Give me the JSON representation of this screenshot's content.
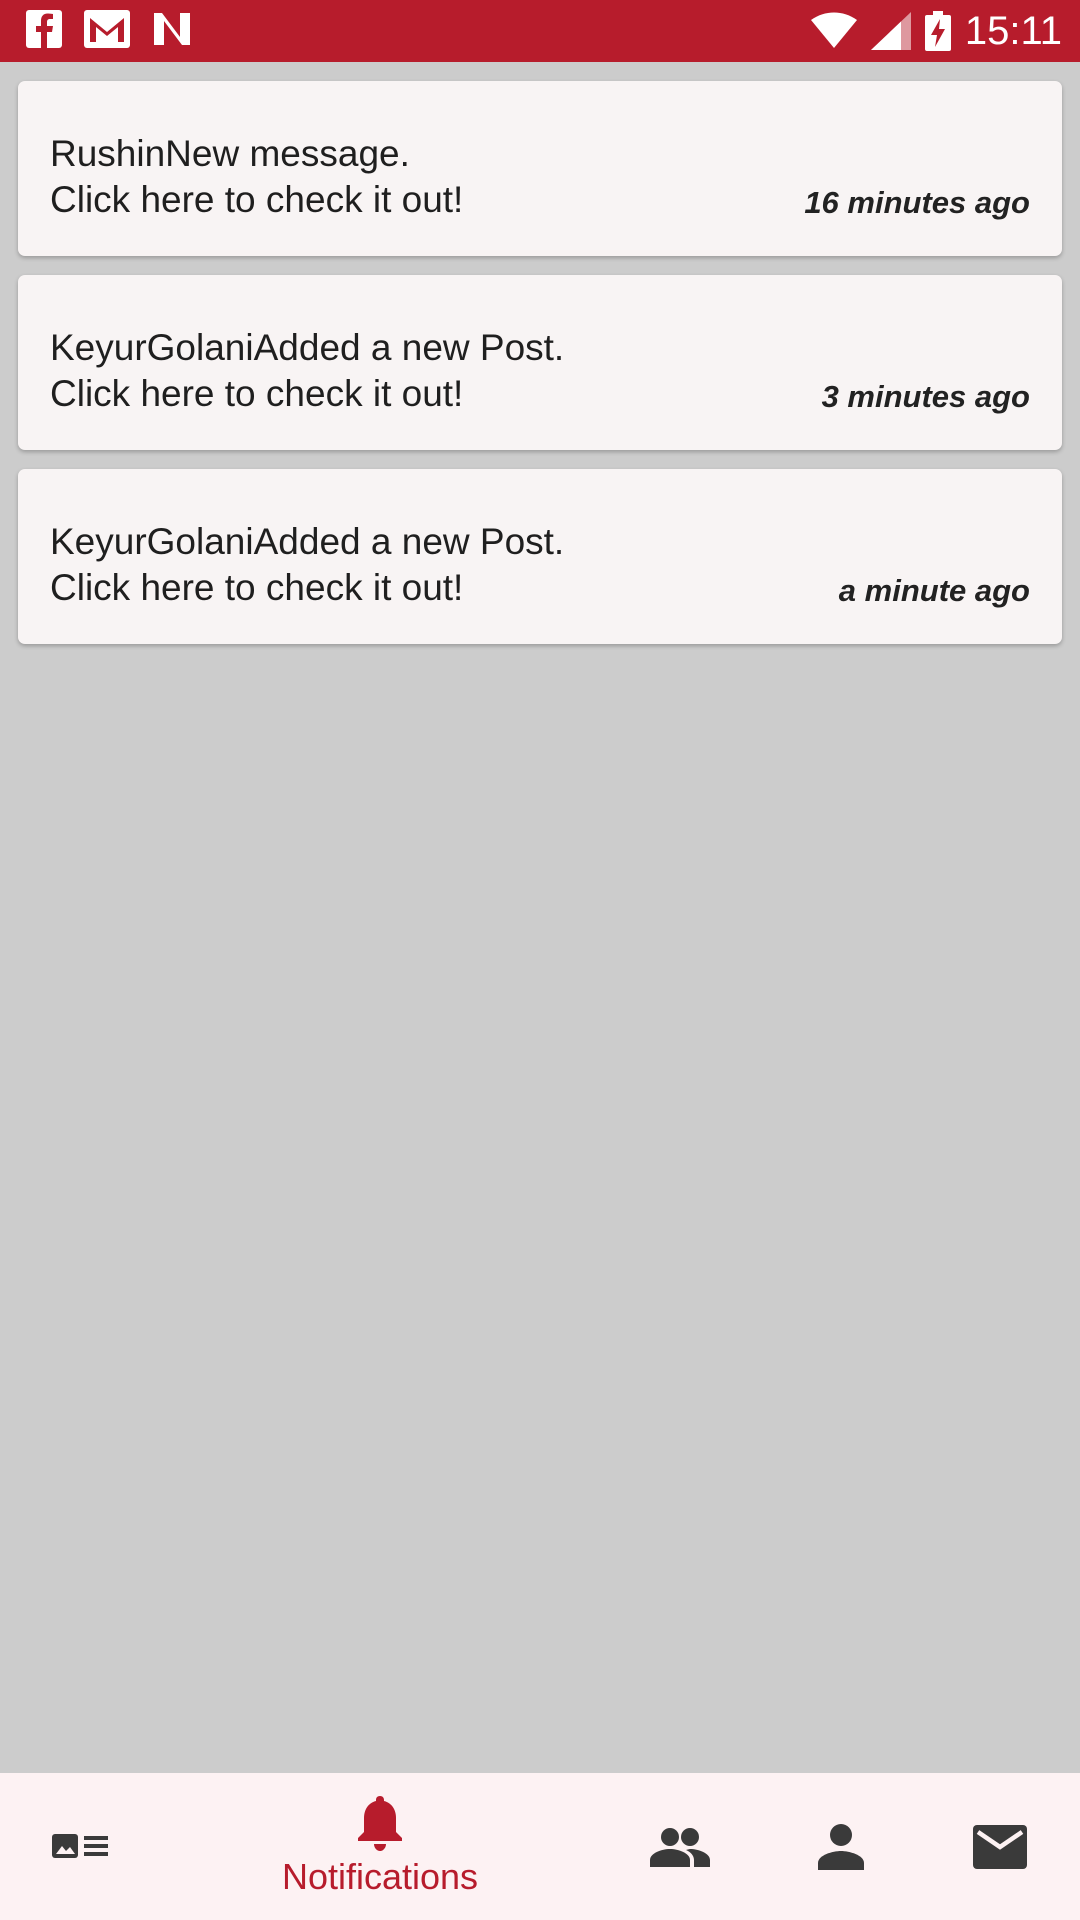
{
  "status_bar": {
    "time": "15:11",
    "left_icons": [
      "facebook-icon",
      "gmail-icon",
      "notification-n-icon"
    ],
    "right_icons": [
      "wifi-icon",
      "signal-icon",
      "battery-charging-icon"
    ]
  },
  "notifications": [
    {
      "line1": "RushinNew message.",
      "line2": "Click here to check it out!",
      "time": "16 minutes ago"
    },
    {
      "line1": "KeyurGolaniAdded a new Post.",
      "line2": "Click here to check it out!",
      "time": "3 minutes ago"
    },
    {
      "line1": "KeyurGolaniAdded a new Post.",
      "line2": "Click here to check it out!",
      "time": "a minute ago"
    }
  ],
  "bottom_nav": {
    "items": [
      {
        "icon": "feed-icon",
        "label": ""
      },
      {
        "icon": "bell-icon",
        "label": "Notifications",
        "active": true
      },
      {
        "icon": "people-icon",
        "label": ""
      },
      {
        "icon": "person-icon",
        "label": ""
      },
      {
        "icon": "mail-icon",
        "label": ""
      }
    ]
  },
  "colors": {
    "accent": "#b71c2c",
    "background": "#cccccc",
    "card": "#f8f4f4",
    "nav_background": "#fdf2f3",
    "nav_icon": "#3a3a3a"
  }
}
